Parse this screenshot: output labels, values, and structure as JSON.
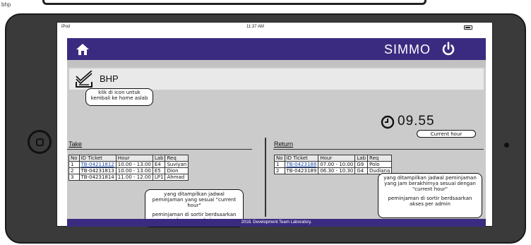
{
  "page_label": "bhp",
  "status_bar": {
    "carrier": "iPod",
    "time": "11:37 AM"
  },
  "navbar": {
    "home_icon": "home-icon",
    "app_title": "SIMMO",
    "power_icon": "power-icon",
    "color": "#3b2b80"
  },
  "section": {
    "title": "BHP",
    "icon": "bhp-stack-icon"
  },
  "clock": {
    "value": "09.55",
    "icon": "clock-icon"
  },
  "annotations": {
    "home_note": "klik di icon untuk kembali ke home aslab",
    "clock_note": "Current hour",
    "take_note_1": "yang ditampilkan jadwal peminjaman yang sesuai \"current hour\"",
    "take_note_2": "peminjaman di sortir berdsaarkan akses per admin",
    "return_note_1": "yang ditampilkan jadwal peminjaman yang jam berakhirnya sesuai dengan \"current hour\"",
    "return_note_2": "peminjaman di sortir berdsaarkan akses per admin"
  },
  "take": {
    "label": "Take",
    "headers": [
      "No",
      "ID Ticket",
      "Hour",
      "Lab",
      "Req"
    ],
    "rows": [
      [
        "1",
        "TB-04211812",
        "10.00 - 13.00",
        "E4",
        "Suviyan"
      ],
      [
        "2",
        "TB-04231813",
        "10.00 - 13.00",
        "E5",
        "Dion"
      ],
      [
        "3",
        "TB-04231814",
        "11.00 - 12.00",
        "LP1",
        "Ahmad"
      ]
    ]
  },
  "return": {
    "label": "Return",
    "headers": [
      "No",
      "ID Ticket",
      "Hour",
      "Lab",
      "Req"
    ],
    "rows": [
      [
        "1",
        "TB-0423188",
        "07.00 - 10.00",
        "G9",
        "Polo"
      ],
      [
        "2",
        "TB-0423189",
        "06.30 - 10.30",
        "G4",
        "Dudiana"
      ]
    ]
  },
  "footer": {
    "text": "2018. Development Team Laboratory."
  }
}
